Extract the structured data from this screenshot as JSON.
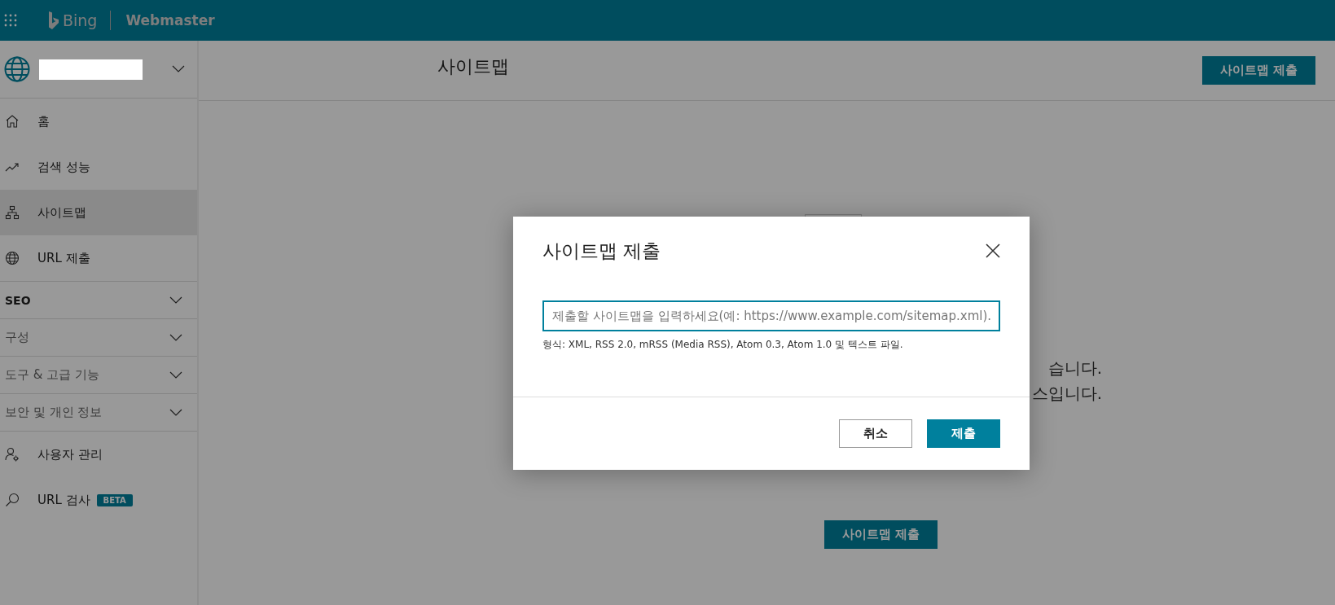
{
  "header": {
    "brand": "Bing",
    "product": "Webmaster"
  },
  "sidebar": {
    "items": [
      {
        "kind": "link",
        "label": "홈",
        "selected": false
      },
      {
        "kind": "link",
        "label": "검색 성능",
        "selected": false
      },
      {
        "kind": "link",
        "label": "사이트맵",
        "selected": true
      },
      {
        "kind": "link",
        "label": "URL 제출",
        "selected": false
      },
      {
        "kind": "section",
        "label": "SEO",
        "expanded": false,
        "emphasized": true
      },
      {
        "kind": "section",
        "label": "구성",
        "expanded": false,
        "emphasized": false
      },
      {
        "kind": "section",
        "label": "도구 & 고급 기능",
        "expanded": false,
        "emphasized": false
      },
      {
        "kind": "section",
        "label": "보안 및 개인 정보",
        "expanded": false,
        "emphasized": false
      },
      {
        "kind": "link",
        "label": "사용자 관리",
        "selected": false
      },
      {
        "kind": "link",
        "label": "URL 검사",
        "selected": false,
        "badge": "BETA"
      }
    ]
  },
  "main": {
    "title": "사이트맵",
    "submit_button": "사이트맵 제출",
    "empty_text": [
      "습니다.",
      "스입니다."
    ],
    "empty_button": "사이트맵 제출"
  },
  "dialog": {
    "title": "사이트맵 제출",
    "input": {
      "placeholder": "제출할 사이트맵을 입력하세요(예: https://www.example.com/sitemap.xml)."
    },
    "hint": "형식: XML, RSS 2.0, mRSS (Media RSS), Atom 0.3, Atom 1.0 및 텍스트 파일.",
    "cancel_button": "취소",
    "submit_button": "제출"
  }
}
